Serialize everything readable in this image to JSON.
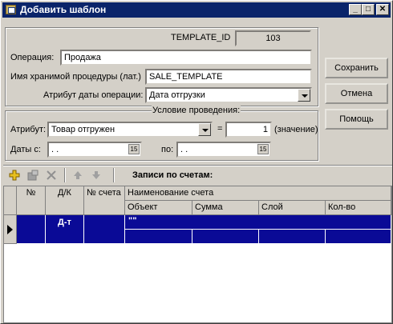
{
  "window": {
    "title": "Добавить шаблон",
    "min": "_",
    "max": "□",
    "close": "✕"
  },
  "template_id": {
    "label": "TEMPLATE_ID",
    "value": "103"
  },
  "operation": {
    "label": "Операция:",
    "value": "Продажа"
  },
  "procedure": {
    "label": "Имя хранимой процедуры (лат.)",
    "value": "SALE_TEMPLATE"
  },
  "date_attr": {
    "label": "Атрибут даты операции:",
    "value": "Дата отгрузки"
  },
  "conditions": {
    "title": "Условие проведения:",
    "attr_label": "Атрибут:",
    "attr_value": "Товар отгружен",
    "eq": "=",
    "value": "1",
    "value_hint": "(значение)",
    "dates_from_label": "Даты с:",
    "dates_from": " .  .",
    "dates_to_label": "по:",
    "dates_to": " .  .",
    "cal": "15"
  },
  "buttons": {
    "save": "Сохранить",
    "cancel": "Отмена",
    "help": "Помощь"
  },
  "toolbar": {
    "title": "Записи по счетам:"
  },
  "grid": {
    "headers": {
      "num": "№",
      "dk": "Д/К",
      "account": "№ счета",
      "account_name": "Наименование счета"
    },
    "subheaders": [
      "Объект",
      "Сумма",
      "Слой",
      "Кол-во"
    ],
    "row": {
      "dk": "Д-т",
      "object": "\"\""
    }
  },
  "colors": {
    "title_bar": "#0a246a",
    "row_selected": "#0a0a96",
    "face": "#d4d0c8"
  }
}
